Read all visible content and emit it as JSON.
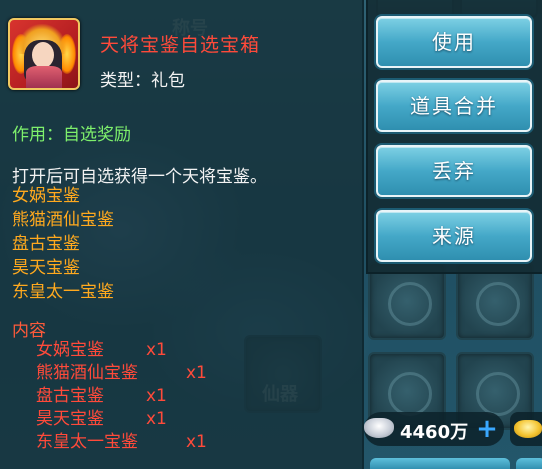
{
  "item": {
    "title": "天将宝鉴自选宝箱",
    "type": "类型：礼包",
    "effect": "作用：自选奖励",
    "description": "打开后可自选获得一个天将宝鉴。",
    "choices": [
      "女娲宝鉴",
      "熊猫酒仙宝鉴",
      "盘古宝鉴",
      "昊天宝鉴",
      "东皇太一宝鉴"
    ],
    "contents_header": "内容",
    "contents": [
      {
        "name": "女娲宝鉴",
        "qty": "x1"
      },
      {
        "name": "熊猫酒仙宝鉴",
        "qty": "x1"
      },
      {
        "name": "盘古宝鉴",
        "qty": "x1"
      },
      {
        "name": "昊天宝鉴",
        "qty": "x1"
      },
      {
        "name": "东皇太一宝鉴",
        "qty": "x1"
      }
    ]
  },
  "actions": {
    "use": "使用",
    "merge": "道具合并",
    "discard": "丢弃",
    "source": "来源"
  },
  "currency": {
    "silver": "4460万"
  },
  "background": {
    "title_label": "称号",
    "artifact_label": "仙器"
  },
  "colors": {
    "title": "#ff4a3a",
    "effect": "#7ef06c",
    "choice": "#ffa91e",
    "button": "#44a8c8"
  }
}
